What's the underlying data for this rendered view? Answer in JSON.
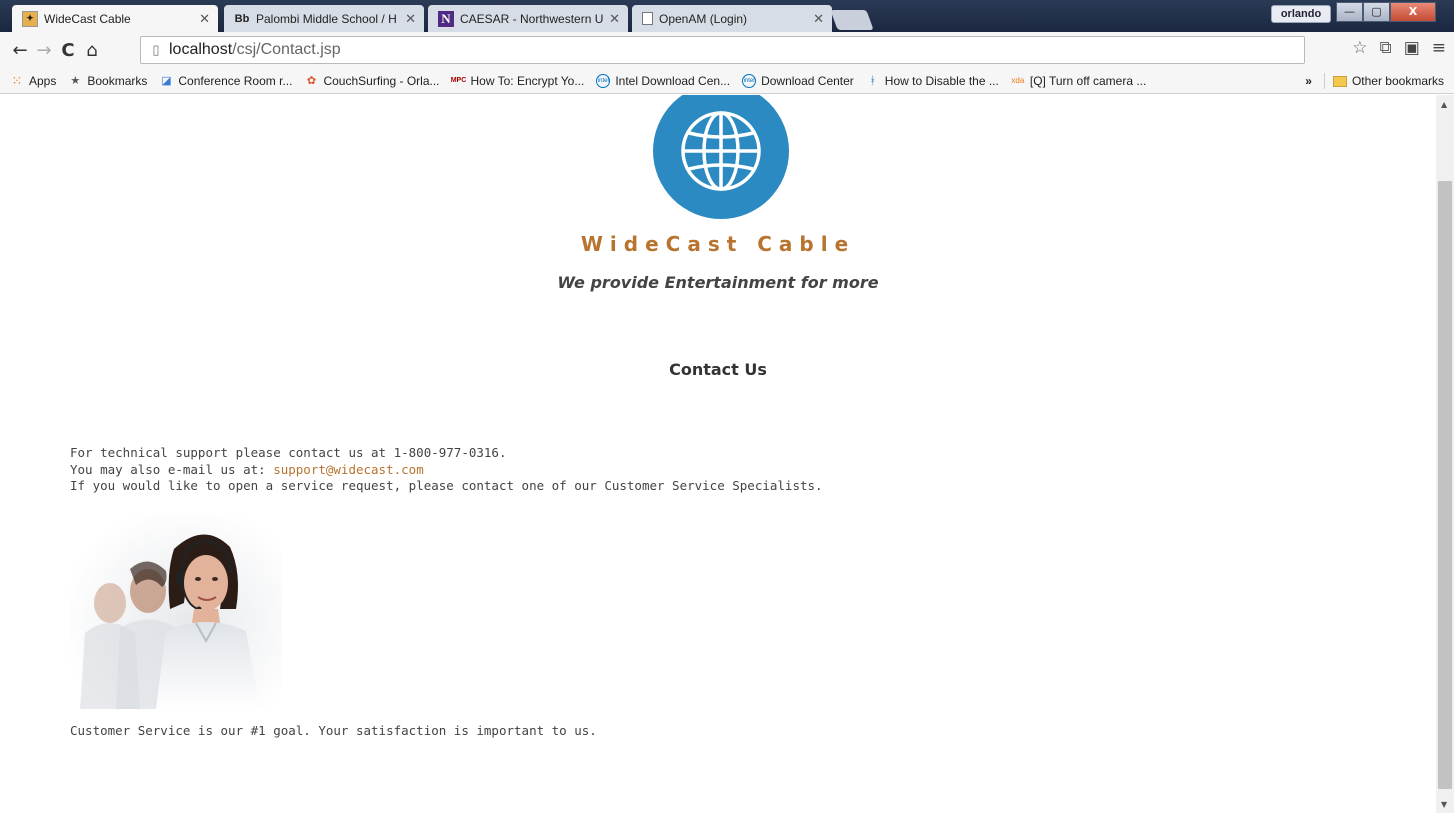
{
  "tabs": [
    {
      "title": "WideCast Cable",
      "icon": "widecast-favicon",
      "active": true
    },
    {
      "title": "Palombi Middle School / H",
      "icon": "blackboard-favicon",
      "fav_text": "Bb",
      "active": false
    },
    {
      "title": "CAESAR - Northwestern U",
      "icon": "northwestern-favicon",
      "fav_text": "N",
      "active": false
    },
    {
      "title": "OpenAM (Login)",
      "icon": "page-icon",
      "active": false
    }
  ],
  "window": {
    "profile": "orlando",
    "minimize": "—",
    "maximize": "▢",
    "close": "X"
  },
  "address_bar": {
    "host": "localhost",
    "path": "/csj/Contact.jsp"
  },
  "bookmarks": {
    "apps": "Apps",
    "bookmarks": "Bookmarks",
    "items": [
      {
        "label": "Conference Room r...",
        "icon": "conference-icon"
      },
      {
        "label": "CouchSurfing - Orla...",
        "icon": "couchsurfing-icon"
      },
      {
        "label": "How To: Encrypt Yo...",
        "icon": "mpc-icon",
        "fav_text": "MPC"
      },
      {
        "label": "Intel Download Cen...",
        "icon": "intel-icon",
        "fav_text": "intel"
      },
      {
        "label": "Download Center",
        "icon": "intel-icon",
        "fav_text": "intel"
      },
      {
        "label": "How to Disable the ...",
        "icon": "person-icon"
      },
      {
        "label": "[Q] Turn off camera ...",
        "icon": "xda-icon",
        "fav_text": "xda"
      }
    ],
    "overflow": "»",
    "other": "Other bookmarks"
  },
  "page": {
    "brand": "WideCast Cable",
    "tagline": "We provide Entertainment for more",
    "heading": "Contact Us",
    "line1": "For technical support please contact us at 1-800-977-0316.",
    "line2_prefix": "You may also e-mail us at: ",
    "email": "support@widecast.com",
    "line3": "If you would like to open a service request, please contact one of our Customer Service Specialists.",
    "footer": "Customer Service is our #1 goal. Your satisfaction is important to us."
  },
  "colors": {
    "brand": "#b8742f",
    "logo": "#2b8ac1"
  }
}
